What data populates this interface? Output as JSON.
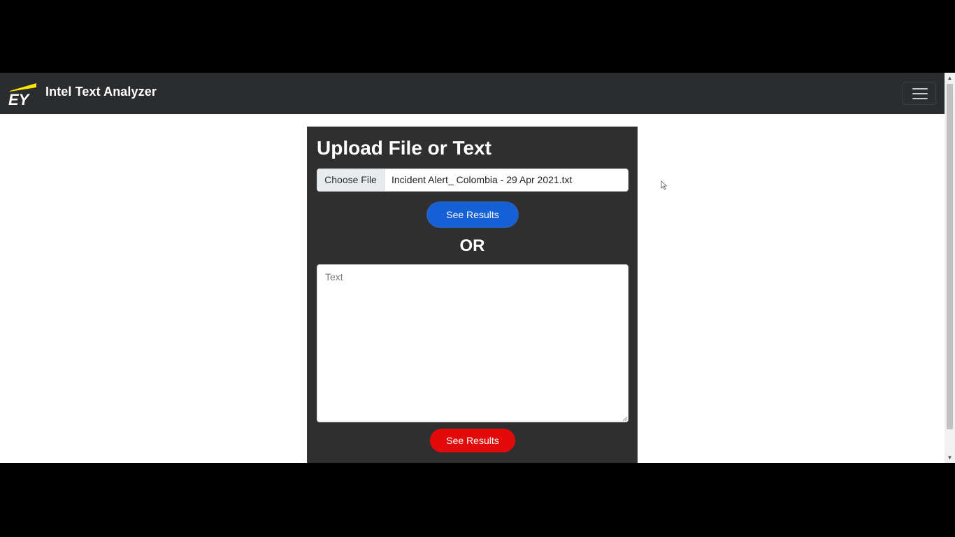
{
  "navbar": {
    "logo_text": "EY",
    "brand": "Intel Text Analyzer",
    "toggler_icon": "hamburger-menu-icon"
  },
  "upload_card": {
    "title": "Upload File or Text",
    "file_input": {
      "button_label": "Choose File",
      "file_name": "Incident Alert_ Colombia - 29 Apr 2021.txt"
    },
    "file_submit_label": "See Results",
    "separator": "OR",
    "text_input": {
      "placeholder": "Text",
      "value": ""
    },
    "text_submit_label": "See Results"
  },
  "colors": {
    "navbar_bg": "#2b2c2e",
    "card_bg": "#2f2f30",
    "logo_yellow": "#ffe600",
    "primary_button": "#1460d6",
    "danger_button": "#e20a0a"
  }
}
